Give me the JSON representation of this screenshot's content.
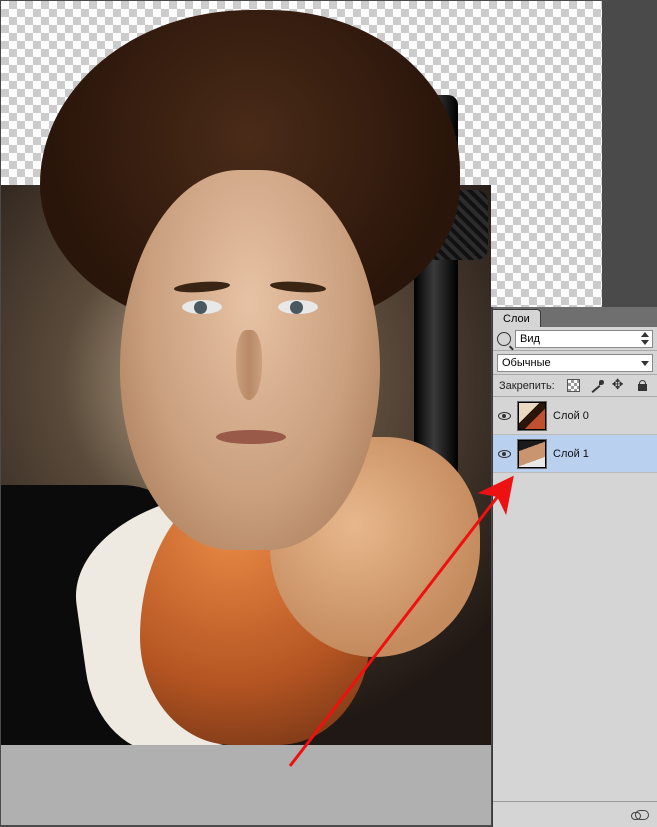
{
  "panel": {
    "tab_label": "Слои",
    "search_placeholder": "Вид",
    "blend_mode": "Обычные",
    "lock_label": "Закрепить:"
  },
  "layers": [
    {
      "name": "Слой 0",
      "selected": false
    },
    {
      "name": "Слой 1",
      "selected": true
    }
  ]
}
